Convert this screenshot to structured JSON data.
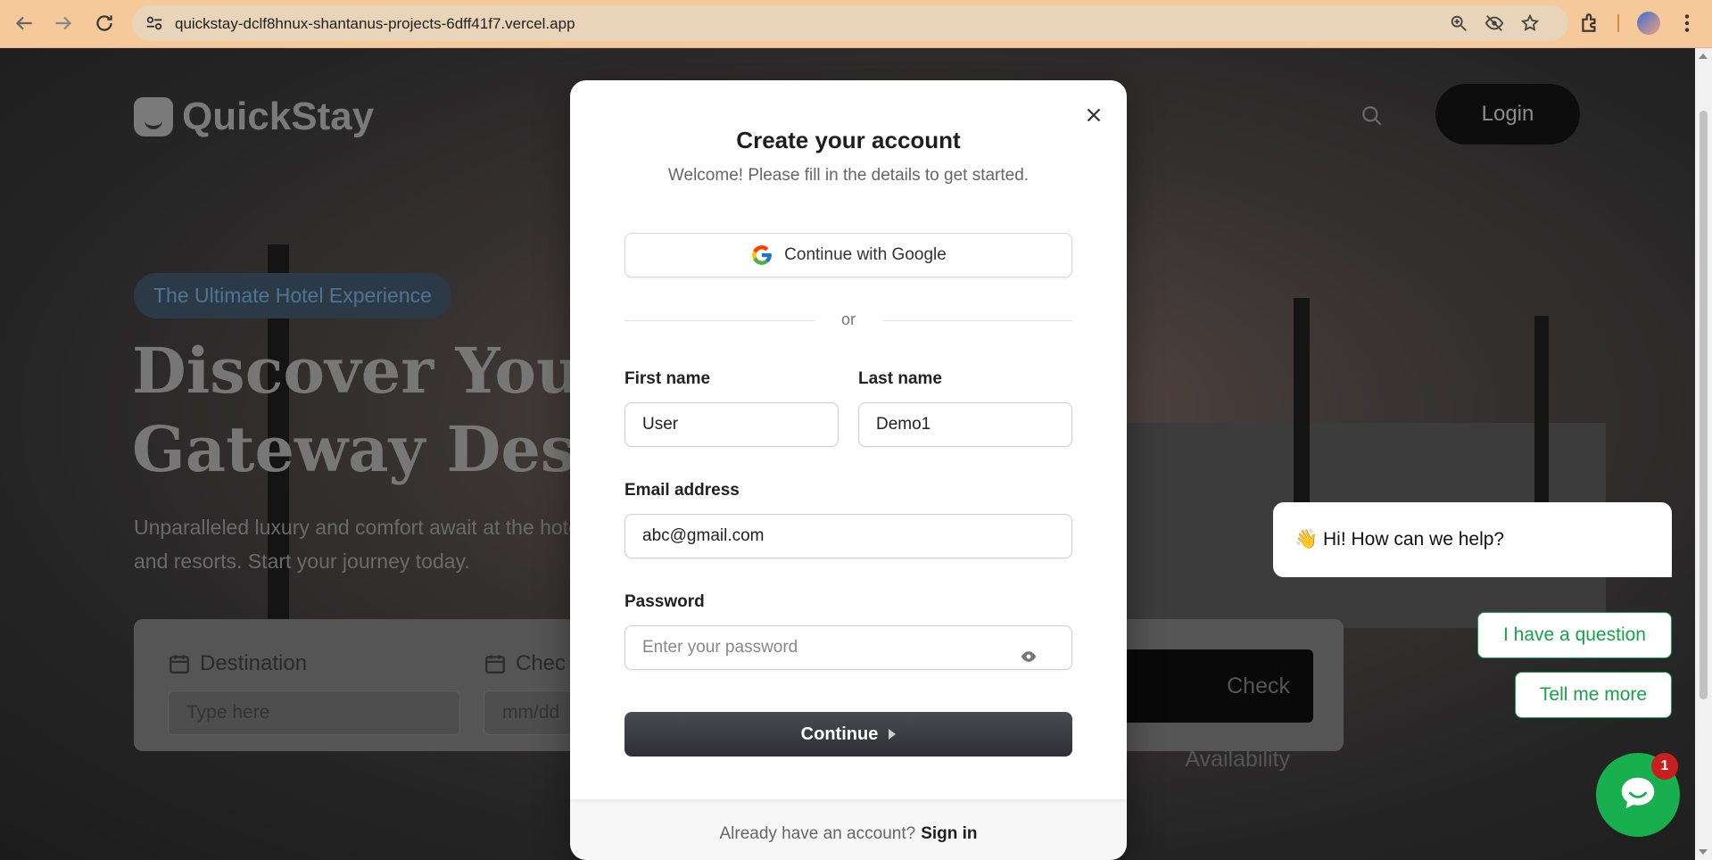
{
  "browser": {
    "url": "quickstay-dclf8hnux-shantanus-projects-6dff41f7.vercel.app",
    "icons": [
      "back-icon",
      "forward-icon",
      "reload-icon",
      "site-settings-icon",
      "zoom-icon",
      "eye-off-icon",
      "star-icon",
      "extensions-icon",
      "profile-avatar",
      "menu-icon"
    ]
  },
  "site": {
    "logo_text": "QuickStay",
    "login_label": "Login",
    "badge": "The Ultimate Hotel Experience",
    "headline": "Discover Your\nGateway Dest",
    "subtext": "Unparalleled luxury and comfort await at the hotels and resorts. Start your journey today.",
    "search": {
      "destination_label": "Destination",
      "destination_placeholder": "Type here",
      "checkin_label": "Chec",
      "checkin_placeholder": "mm/dd",
      "check_button": "Check Availability"
    }
  },
  "modal": {
    "title": "Create your account",
    "subtitle": "Welcome! Please fill in the details to get started.",
    "google_label": "Continue with Google",
    "or_label": "or",
    "first_name_label": "First name",
    "first_name_value": "User",
    "last_name_label": "Last name",
    "last_name_value": "Demo1",
    "email_label": "Email address",
    "email_value": "abc@gmail.com",
    "password_label": "Password",
    "password_placeholder": "Enter your password",
    "continue_label": "Continue",
    "footer_text": "Already have an account?",
    "signin_label": "Sign in"
  },
  "chat": {
    "greeting_emoji": "👋",
    "greeting": "Hi! How can we help?",
    "option_1": "I have a question",
    "option_2": "Tell me more",
    "notification_count": "1"
  },
  "colors": {
    "chrome": "#f6c99a",
    "chat_green": "#18b04f",
    "notif_red": "#c81e1e",
    "button_dark": "#2e2e34"
  }
}
